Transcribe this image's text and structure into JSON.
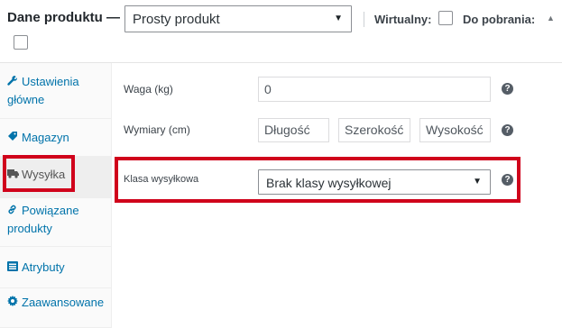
{
  "header": {
    "title": "Dane produktu —",
    "product_type": "Prosty produkt",
    "virtual_label": "Wirtualny:",
    "downloadable_label": "Do pobrania:",
    "virtual_checked": false,
    "downloadable_checked": false
  },
  "tabs": [
    {
      "label": "Ustawienia główne",
      "icon": "wrench-icon",
      "active": false
    },
    {
      "label": "Magazyn",
      "icon": "tag-icon",
      "active": false
    },
    {
      "label": "Wysyłka",
      "icon": "truck-icon",
      "active": true
    },
    {
      "label": "Powiązane produkty",
      "icon": "link-icon",
      "active": false
    },
    {
      "label": "Atrybuty",
      "icon": "list-icon",
      "active": false
    },
    {
      "label": "Zaawansowane",
      "icon": "gear-icon",
      "active": false
    }
  ],
  "shipping": {
    "weight_label": "Waga (kg)",
    "weight_placeholder": "0",
    "dimensions_label": "Wymiary (cm)",
    "length_placeholder": "Długość",
    "width_placeholder": "Szerokość",
    "height_placeholder": "Wysokość",
    "class_label": "Klasa wysyłkowa",
    "class_value": "Brak klasy wysyłkowej"
  },
  "colors": {
    "highlight": "#d0021b",
    "link": "#0073aa"
  }
}
